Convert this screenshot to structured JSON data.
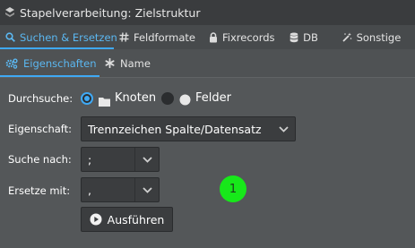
{
  "window": {
    "title": "Stapelverarbeitung: Zielstruktur"
  },
  "tabs": [
    {
      "label": "Suchen & Ersetzen",
      "icon": "search-icon",
      "active": true
    },
    {
      "label": "Feldformate",
      "icon": "hash-icon",
      "active": false
    },
    {
      "label": "Fixrecords",
      "icon": "lock-icon",
      "active": false
    },
    {
      "label": "DB",
      "icon": "database-icon",
      "active": false
    },
    {
      "label": "Sonstige",
      "icon": "magic-wand-icon",
      "active": false
    }
  ],
  "subtabs": [
    {
      "label": "Eigenschaften",
      "icon": "gears-icon",
      "active": true
    },
    {
      "label": "Name",
      "icon": "asterisk-icon",
      "active": false
    }
  ],
  "form": {
    "durchsuche_label": "Durchsuche:",
    "options": [
      {
        "label": "Knoten",
        "icon": "folder-icon",
        "checked": true
      },
      {
        "label": "Felder",
        "icon": "circle-icon",
        "checked": false
      }
    ],
    "eigenschaft_label": "Eigenschaft:",
    "eigenschaft_value": "Trennzeichen Spalte/Datensatz",
    "suche_label": "Suche nach:",
    "suche_value": ";",
    "ersetze_label": "Ersetze mit:",
    "ersetze_value": ",",
    "run_label": "Ausführen"
  },
  "annotation": {
    "label": "1"
  },
  "colors": {
    "accent": "#3fa9f5",
    "background": "#545759",
    "badge": "#17e81a"
  }
}
